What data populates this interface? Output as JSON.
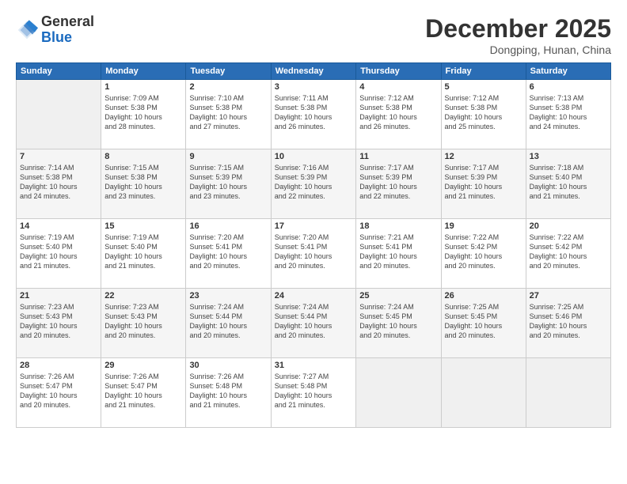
{
  "header": {
    "logo_general": "General",
    "logo_blue": "Blue",
    "month": "December 2025",
    "location": "Dongping, Hunan, China"
  },
  "days_of_week": [
    "Sunday",
    "Monday",
    "Tuesday",
    "Wednesday",
    "Thursday",
    "Friday",
    "Saturday"
  ],
  "weeks": [
    [
      {
        "day": "",
        "info": ""
      },
      {
        "day": "1",
        "info": "Sunrise: 7:09 AM\nSunset: 5:38 PM\nDaylight: 10 hours\nand 28 minutes."
      },
      {
        "day": "2",
        "info": "Sunrise: 7:10 AM\nSunset: 5:38 PM\nDaylight: 10 hours\nand 27 minutes."
      },
      {
        "day": "3",
        "info": "Sunrise: 7:11 AM\nSunset: 5:38 PM\nDaylight: 10 hours\nand 26 minutes."
      },
      {
        "day": "4",
        "info": "Sunrise: 7:12 AM\nSunset: 5:38 PM\nDaylight: 10 hours\nand 26 minutes."
      },
      {
        "day": "5",
        "info": "Sunrise: 7:12 AM\nSunset: 5:38 PM\nDaylight: 10 hours\nand 25 minutes."
      },
      {
        "day": "6",
        "info": "Sunrise: 7:13 AM\nSunset: 5:38 PM\nDaylight: 10 hours\nand 24 minutes."
      }
    ],
    [
      {
        "day": "7",
        "info": "Sunrise: 7:14 AM\nSunset: 5:38 PM\nDaylight: 10 hours\nand 24 minutes."
      },
      {
        "day": "8",
        "info": "Sunrise: 7:15 AM\nSunset: 5:38 PM\nDaylight: 10 hours\nand 23 minutes."
      },
      {
        "day": "9",
        "info": "Sunrise: 7:15 AM\nSunset: 5:39 PM\nDaylight: 10 hours\nand 23 minutes."
      },
      {
        "day": "10",
        "info": "Sunrise: 7:16 AM\nSunset: 5:39 PM\nDaylight: 10 hours\nand 22 minutes."
      },
      {
        "day": "11",
        "info": "Sunrise: 7:17 AM\nSunset: 5:39 PM\nDaylight: 10 hours\nand 22 minutes."
      },
      {
        "day": "12",
        "info": "Sunrise: 7:17 AM\nSunset: 5:39 PM\nDaylight: 10 hours\nand 21 minutes."
      },
      {
        "day": "13",
        "info": "Sunrise: 7:18 AM\nSunset: 5:40 PM\nDaylight: 10 hours\nand 21 minutes."
      }
    ],
    [
      {
        "day": "14",
        "info": "Sunrise: 7:19 AM\nSunset: 5:40 PM\nDaylight: 10 hours\nand 21 minutes."
      },
      {
        "day": "15",
        "info": "Sunrise: 7:19 AM\nSunset: 5:40 PM\nDaylight: 10 hours\nand 21 minutes."
      },
      {
        "day": "16",
        "info": "Sunrise: 7:20 AM\nSunset: 5:41 PM\nDaylight: 10 hours\nand 20 minutes."
      },
      {
        "day": "17",
        "info": "Sunrise: 7:20 AM\nSunset: 5:41 PM\nDaylight: 10 hours\nand 20 minutes."
      },
      {
        "day": "18",
        "info": "Sunrise: 7:21 AM\nSunset: 5:41 PM\nDaylight: 10 hours\nand 20 minutes."
      },
      {
        "day": "19",
        "info": "Sunrise: 7:22 AM\nSunset: 5:42 PM\nDaylight: 10 hours\nand 20 minutes."
      },
      {
        "day": "20",
        "info": "Sunrise: 7:22 AM\nSunset: 5:42 PM\nDaylight: 10 hours\nand 20 minutes."
      }
    ],
    [
      {
        "day": "21",
        "info": "Sunrise: 7:23 AM\nSunset: 5:43 PM\nDaylight: 10 hours\nand 20 minutes."
      },
      {
        "day": "22",
        "info": "Sunrise: 7:23 AM\nSunset: 5:43 PM\nDaylight: 10 hours\nand 20 minutes."
      },
      {
        "day": "23",
        "info": "Sunrise: 7:24 AM\nSunset: 5:44 PM\nDaylight: 10 hours\nand 20 minutes."
      },
      {
        "day": "24",
        "info": "Sunrise: 7:24 AM\nSunset: 5:44 PM\nDaylight: 10 hours\nand 20 minutes."
      },
      {
        "day": "25",
        "info": "Sunrise: 7:24 AM\nSunset: 5:45 PM\nDaylight: 10 hours\nand 20 minutes."
      },
      {
        "day": "26",
        "info": "Sunrise: 7:25 AM\nSunset: 5:45 PM\nDaylight: 10 hours\nand 20 minutes."
      },
      {
        "day": "27",
        "info": "Sunrise: 7:25 AM\nSunset: 5:46 PM\nDaylight: 10 hours\nand 20 minutes."
      }
    ],
    [
      {
        "day": "28",
        "info": "Sunrise: 7:26 AM\nSunset: 5:47 PM\nDaylight: 10 hours\nand 20 minutes."
      },
      {
        "day": "29",
        "info": "Sunrise: 7:26 AM\nSunset: 5:47 PM\nDaylight: 10 hours\nand 21 minutes."
      },
      {
        "day": "30",
        "info": "Sunrise: 7:26 AM\nSunset: 5:48 PM\nDaylight: 10 hours\nand 21 minutes."
      },
      {
        "day": "31",
        "info": "Sunrise: 7:27 AM\nSunset: 5:48 PM\nDaylight: 10 hours\nand 21 minutes."
      },
      {
        "day": "",
        "info": ""
      },
      {
        "day": "",
        "info": ""
      },
      {
        "day": "",
        "info": ""
      }
    ]
  ]
}
